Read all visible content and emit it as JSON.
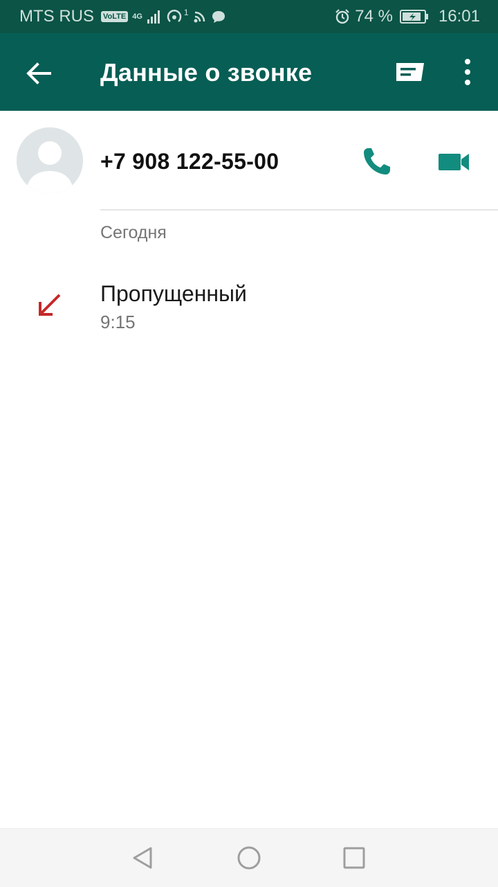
{
  "status_bar": {
    "carrier": "MTS RUS",
    "volte": "VoLTE",
    "network": "4G",
    "hotspot_count": "1",
    "battery": "74 %",
    "time": "16:01"
  },
  "toolbar": {
    "title": "Данные о звонке"
  },
  "contact": {
    "phone_number": "+7 908 122-55-00"
  },
  "history": {
    "date_header": "Сегодня",
    "entries": [
      {
        "type": "Пропущенный",
        "time": "9:15"
      }
    ]
  },
  "colors": {
    "status_bar_bg": "#0b5446",
    "toolbar_bg": "#075e54",
    "accent": "#128c7e",
    "missed": "#c62828"
  },
  "icons": {
    "back": "arrow-left-icon",
    "message": "message-icon",
    "more": "more-vertical-icon",
    "call": "phone-icon",
    "video": "video-camera-icon",
    "missed": "missed-call-arrow-icon"
  }
}
